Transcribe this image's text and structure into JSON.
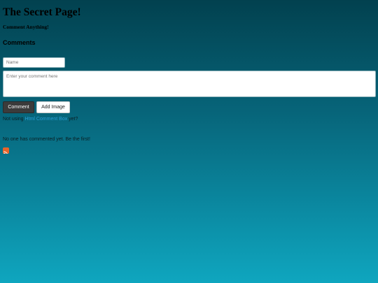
{
  "page": {
    "title": "The Secret Page!",
    "subtitle": "Comment Anything!"
  },
  "comments": {
    "heading": "Comments",
    "name_placeholder": "Name",
    "comment_placeholder": "Enter your comment here",
    "comment_button": "Comment",
    "add_image_button": "Add Image",
    "promo_prefix": "Not using ",
    "promo_link": "Html Comment Box",
    "promo_suffix": " yet?",
    "empty_note": "No one has commented yet. Be the first!",
    "rss_icon": "rss-icon"
  },
  "colors": {
    "link": "#2a9fd6",
    "comment_button_bg": "#3b3b3b",
    "rss_orange": "#e8642a"
  }
}
